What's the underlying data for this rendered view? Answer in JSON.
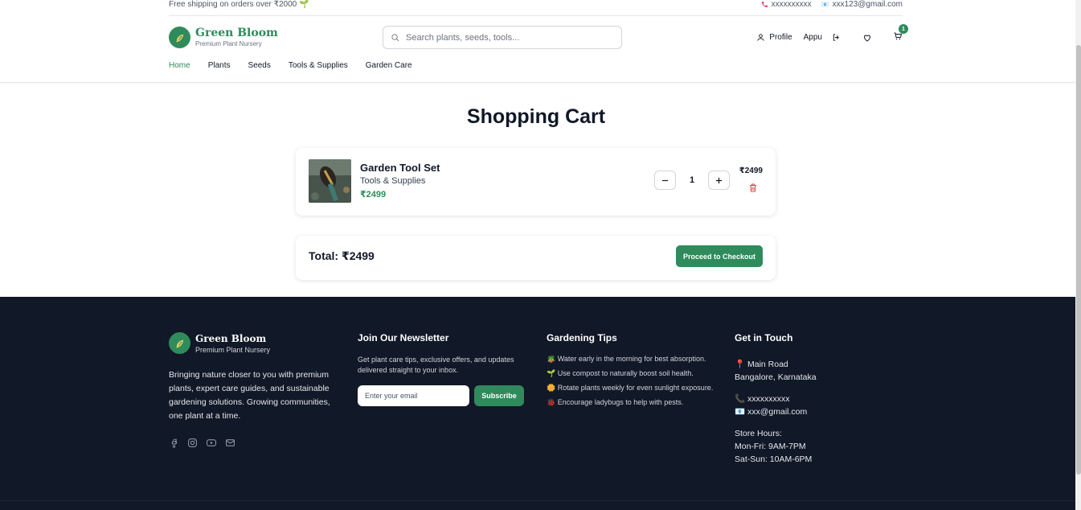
{
  "topbar": {
    "shipping": "Free shipping on orders over ₹2000 🌱",
    "phone": "xxxxxxxxxx",
    "email": "xxx123@gmail.com"
  },
  "brand": {
    "name": "Green Bloom",
    "tagline": "Premium Plant Nursery",
    "accent": "#2f8b5b"
  },
  "search": {
    "placeholder": "Search plants, seeds, tools..."
  },
  "header_actions": {
    "profile": "Profile",
    "username": "Appu",
    "cart_count": "1"
  },
  "menu": [
    "Home",
    "Plants",
    "Seeds",
    "Tools & Supplies",
    "Garden Care"
  ],
  "cart": {
    "title": "Shopping Cart",
    "items": [
      {
        "name": "Garden Tool Set",
        "category": "Tools & Supplies",
        "price": "₹2499",
        "quantity": "1",
        "line_total": "₹2499"
      }
    ],
    "total": "Total: ₹2499",
    "checkout_label": "Proceed to Checkout"
  },
  "footer": {
    "brand_name": "Green Bloom",
    "brand_tagline": "Premium Plant Nursery",
    "description": "Bringing nature closer to you with premium plants, expert care guides, and sustainable gardening solutions. Growing communities, one plant at a time.",
    "newsletter": {
      "heading": "Join Our Newsletter",
      "text": "Get plant care tips, exclusive offers, and updates delivered straight to your inbox.",
      "placeholder": "Enter your email",
      "button": "Subscribe"
    },
    "tips": {
      "heading": "Gardening Tips",
      "items": [
        "🪴 Water early in the morning for best absorption.",
        "🌱 Use compost to naturally boost soil health.",
        "🌼 Rotate plants weekly for even sunlight exposure.",
        "🐞 Encourage ladybugs to help with pests."
      ]
    },
    "contact": {
      "heading": "Get in Touch",
      "address_line1": "📍 Main Road",
      "address_line2": "Bangalore, Karnataka",
      "phone": "📞 xxxxxxxxxx",
      "email": "📧 xxx@gmail.com",
      "hours_heading": "Store Hours:",
      "hours_weekday": "Mon-Fri: 9AM-7PM",
      "hours_weekend": "Sat-Sun: 10AM-6PM"
    }
  }
}
